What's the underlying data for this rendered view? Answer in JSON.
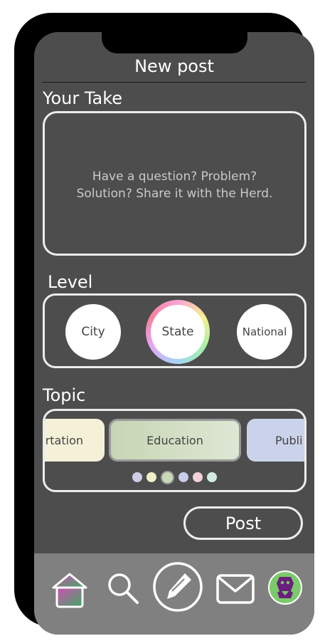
{
  "header": {
    "title": "New post"
  },
  "take": {
    "label": "Your Take",
    "placeholder_line1": "Have a question? Problem?",
    "placeholder_line2": "Solution? Share it with the Herd."
  },
  "level": {
    "label": "Level",
    "options": [
      "City",
      "State",
      "National"
    ],
    "selected": "State"
  },
  "topic": {
    "label": "Topic",
    "cards": [
      {
        "label": "rtation",
        "color": "#f5f1d9"
      },
      {
        "label": "Education",
        "color": "#c6d6b4",
        "selected": true
      },
      {
        "label": "Publi",
        "color": "#cbd3ea"
      }
    ],
    "dot_colors": [
      "#cdcde8",
      "#f1efc8",
      "#c8d9b8",
      "#c8cde9",
      "#f3d1d8",
      "#d1ebe3"
    ],
    "selected_dot": 2
  },
  "actions": {
    "post_label": "Post"
  },
  "navbar": {
    "items": [
      "home-icon",
      "search-icon",
      "compose-icon",
      "mail-icon",
      "profile-avatar"
    ]
  }
}
